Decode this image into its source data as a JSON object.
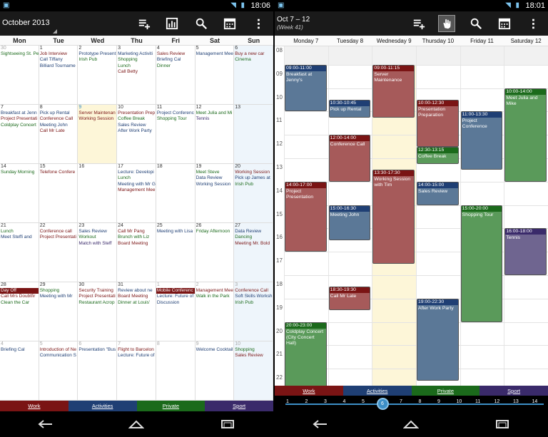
{
  "colors": {
    "work": "#7a1414",
    "activities": "#1f3f74",
    "private": "#1b6a1b",
    "sport": "#3a2a6a"
  },
  "left": {
    "status_time": "18:06",
    "title": "October 2013",
    "action_icons": [
      "add-event-icon",
      "chart-icon",
      "search-icon",
      "calendar-icon",
      "overflow-menu-icon"
    ],
    "weekdays": [
      "Mon",
      "Tue",
      "Wed",
      "Thu",
      "Fri",
      "Sat",
      "Sun"
    ],
    "categories": [
      "Work",
      "Activities",
      "Private",
      "Sport"
    ],
    "weeks": [
      [
        {
          "d": "30",
          "dim": true,
          "ev": [
            [
              "Sightseeing St. Pe",
              "p"
            ]
          ]
        },
        {
          "d": "1",
          "ev": [
            [
              "Job Interview",
              "w"
            ],
            [
              "Call Tiffany",
              "a"
            ],
            [
              "Billiard Tourname",
              "a"
            ]
          ]
        },
        {
          "d": "2",
          "ev": [
            [
              "Prototype Present",
              "a"
            ],
            [
              "Irish Pub",
              "p"
            ]
          ]
        },
        {
          "d": "3",
          "ev": [
            [
              "Marketing Activiti",
              "a"
            ],
            [
              "Shopping",
              "p"
            ],
            [
              "Lunch",
              "p"
            ],
            [
              "Call Betty",
              "w"
            ]
          ]
        },
        {
          "d": "4",
          "ev": [
            [
              "Sales Review",
              "w"
            ],
            [
              "Briefing Cal",
              "a"
            ],
            [
              "Dinner",
              "p"
            ]
          ]
        },
        {
          "d": "5",
          "ev": [
            [
              "Management Mee",
              "a"
            ]
          ]
        },
        {
          "d": "6",
          "ev": [
            [
              "Buy a new car",
              "w"
            ],
            [
              "Cinema",
              "p"
            ]
          ]
        }
      ],
      [
        {
          "d": "7",
          "ev": [
            [
              "Breakfast at Jenn",
              "a"
            ],
            [
              "Project Presentati",
              "w"
            ],
            [
              "Coldplay Concert",
              "p"
            ]
          ]
        },
        {
          "d": "8",
          "ev": [
            [
              "Pick up Rental",
              "a"
            ],
            [
              "Conference Call",
              "w"
            ],
            [
              "Meeting John",
              "a"
            ],
            [
              "Call Mr Late",
              "w"
            ]
          ]
        },
        {
          "d": "9",
          "ev": [
            [
              "Server Maintenan",
              "w"
            ],
            [
              "Working Session",
              "w"
            ]
          ],
          "today": true
        },
        {
          "d": "10",
          "ev": [
            [
              "Presentation Prep",
              "w"
            ],
            [
              "Coffee Break",
              "p"
            ],
            [
              "Sales Review",
              "a"
            ],
            [
              "After Work Party",
              "a"
            ]
          ]
        },
        {
          "d": "11",
          "ev": [
            [
              "Project Conferenc",
              "a"
            ],
            [
              "Shopping Tour",
              "p"
            ]
          ]
        },
        {
          "d": "12",
          "ev": [
            [
              "Meet Julia and Mi",
              "p"
            ],
            [
              "Tennis",
              "s"
            ]
          ]
        },
        {
          "d": "13",
          "ev": []
        }
      ],
      [
        {
          "d": "14",
          "ev": [
            [
              "Sunday Morning",
              "p"
            ]
          ]
        },
        {
          "d": "15",
          "ev": [
            [
              "Telefone Confere",
              "w"
            ]
          ]
        },
        {
          "d": "16",
          "ev": []
        },
        {
          "d": "17",
          "ev": [
            [
              "Lecture: Developi",
              "a"
            ],
            [
              "Lunch",
              "p"
            ],
            [
              "Meeting with Mr G",
              "a"
            ],
            [
              "Management Mee",
              "w"
            ]
          ]
        },
        {
          "d": "18",
          "ev": []
        },
        {
          "d": "19",
          "ev": [
            [
              "Meet Steve",
              "p"
            ],
            [
              "Data Review",
              "a"
            ],
            [
              "Working Session",
              "a"
            ]
          ]
        },
        {
          "d": "20",
          "ev": [
            [
              "Working Session",
              "w"
            ],
            [
              "Pick up James at",
              "a"
            ],
            [
              "Irish Pub",
              "p"
            ]
          ]
        }
      ],
      [
        {
          "d": "21",
          "ev": [
            [
              "Lunch",
              "p"
            ],
            [
              "Meet Steffi and",
              "a"
            ]
          ]
        },
        {
          "d": "22",
          "ev": [
            [
              "Conference call",
              "w"
            ],
            [
              "Project Presentati",
              "w"
            ]
          ]
        },
        {
          "d": "23",
          "ev": [
            [
              "Sales Review",
              "a"
            ],
            [
              "Workout",
              "p"
            ],
            [
              "Match with Steff",
              "s"
            ]
          ]
        },
        {
          "d": "24",
          "ev": [
            [
              "Call Mr Pang",
              "w"
            ],
            [
              "Brunch with Liz",
              "p"
            ],
            [
              "Board Meeting",
              "w"
            ]
          ]
        },
        {
          "d": "25",
          "ev": [
            [
              "Meeting with Lisa",
              "a"
            ]
          ]
        },
        {
          "d": "26",
          "ev": [
            [
              "Friday Afternoon",
              "p"
            ]
          ]
        },
        {
          "d": "27",
          "ev": [
            [
              "Data Review",
              "a"
            ],
            [
              "Dancing",
              "p"
            ],
            [
              "Meeting Mr. Bold",
              "w"
            ]
          ]
        }
      ],
      [
        {
          "d": "28",
          "ev": [
            [
              "Day Off",
              "hlw"
            ],
            [
              "Call Mrs Doubtfir",
              "w"
            ],
            [
              "Clean the Car",
              "p"
            ]
          ]
        },
        {
          "d": "29",
          "ev": [
            [
              "Shopping",
              "p"
            ],
            [
              "Meeting with Mr",
              "a"
            ]
          ]
        },
        {
          "d": "30",
          "ev": [
            [
              "Security Training",
              "w"
            ],
            [
              "Project Presentati",
              "w"
            ],
            [
              "Restaurant Acrop",
              "p"
            ]
          ]
        },
        {
          "d": "31",
          "ev": [
            [
              "Review about ne",
              "a"
            ],
            [
              "Board Meeting",
              "w"
            ],
            [
              "Dinner at Louis'",
              "p"
            ]
          ]
        },
        {
          "d": "1",
          "dim": true,
          "ev": [
            [
              "Mobile Conferenc",
              "hlw"
            ],
            [
              "Lecture: Future of",
              "a"
            ],
            [
              "Discussion",
              "a"
            ]
          ]
        },
        {
          "d": "2",
          "dim": true,
          "ev": [
            [
              "Management Mee",
              "w"
            ],
            [
              "Walk in the Park",
              "p"
            ]
          ]
        },
        {
          "d": "3",
          "dim": true,
          "ev": [
            [
              "Conference Call",
              "w"
            ],
            [
              "Soft Skills Worksh",
              "a"
            ],
            [
              "Irish Pub",
              "p"
            ]
          ]
        }
      ],
      [
        {
          "d": "4",
          "dim": true,
          "ev": [
            [
              "Briefing Cal",
              "a"
            ]
          ]
        },
        {
          "d": "5",
          "dim": true,
          "ev": [
            [
              "Introduction of Ne",
              "w"
            ],
            [
              "Communication S",
              "a"
            ]
          ]
        },
        {
          "d": "6",
          "dim": true,
          "ev": [
            [
              "Presentation \"Bus",
              "a"
            ]
          ]
        },
        {
          "d": "7",
          "dim": true,
          "ev": [
            [
              "Flight to Barcelon",
              "w"
            ],
            [
              "Lecture: Future of",
              "a"
            ]
          ]
        },
        {
          "d": "8",
          "dim": true,
          "ev": []
        },
        {
          "d": "9",
          "dim": true,
          "ev": [
            [
              "Welcome Cocktail",
              "a"
            ]
          ]
        },
        {
          "d": "10",
          "dim": true,
          "ev": [
            [
              "Shopping",
              "p"
            ],
            [
              "Sales Review",
              "w"
            ]
          ]
        }
      ]
    ]
  },
  "right": {
    "status_time": "18:01",
    "title": "Oct 7 – 12",
    "subtitle": "(Week 41)",
    "action_icons": [
      "add-event-icon",
      "touch-icon",
      "search-icon",
      "calendar-icon",
      "overflow-menu-icon"
    ],
    "days": [
      "Monday 7",
      "Tuesday 8",
      "Wednesday 9",
      "Thursday 10",
      "Friday 11",
      "Saturday 12"
    ],
    "hours": [
      "08",
      "09",
      "10",
      "11",
      "12",
      "13",
      "14",
      "15",
      "16",
      "17",
      "18",
      "19",
      "20",
      "21",
      "22"
    ],
    "categories": [
      "Work",
      "Activities",
      "Private",
      "Sport"
    ],
    "slider_ticks": [
      "1",
      "2",
      "3",
      "4",
      "5",
      "6",
      "7",
      "8",
      "9",
      "10",
      "11",
      "12",
      "13",
      "14"
    ],
    "slider_value": "6",
    "events": [
      {
        "day": 0,
        "start": 9.0,
        "end": 11.0,
        "time": "09:00-11:00",
        "text": "Breakfast at Jenny's",
        "cat": "activities"
      },
      {
        "day": 0,
        "start": 14.0,
        "end": 17.0,
        "time": "14:00-17:00",
        "text": "Project Presentation",
        "cat": "work"
      },
      {
        "day": 0,
        "start": 20.0,
        "end": 23.0,
        "time": "20:00-23:00",
        "text": "Coldplay Concert (City Concert Hall)",
        "cat": "private"
      },
      {
        "day": 1,
        "start": 10.5,
        "end": 11.25,
        "time": "10:30-10:45",
        "text": "Pick up Rental",
        "cat": "activities"
      },
      {
        "day": 1,
        "start": 12.0,
        "end": 14.0,
        "time": "12:00-14:00",
        "text": "Conference Call",
        "cat": "work"
      },
      {
        "day": 1,
        "start": 15.0,
        "end": 16.5,
        "time": "15:00-16:30",
        "text": "Meeting John",
        "cat": "activities"
      },
      {
        "day": 1,
        "start": 18.5,
        "end": 19.5,
        "time": "18:30-19:30",
        "text": "Call Mr Late",
        "cat": "work"
      },
      {
        "day": 2,
        "start": 9.0,
        "end": 11.25,
        "time": "09:00-11:15",
        "text": "Server Maintenance",
        "cat": "work"
      },
      {
        "day": 2,
        "start": 13.5,
        "end": 17.5,
        "time": "13:30-17:30",
        "text": "Working Session with Tim",
        "cat": "work"
      },
      {
        "day": 3,
        "start": 10.5,
        "end": 12.5,
        "time": "10:00-12:30",
        "text": "Presentation Preparation",
        "cat": "work"
      },
      {
        "day": 3,
        "start": 12.5,
        "end": 13.25,
        "time": "12:30-13:15",
        "text": "Coffee Break",
        "cat": "private"
      },
      {
        "day": 3,
        "start": 14.0,
        "end": 15.0,
        "time": "14:00-15:00",
        "text": "Sales Review",
        "cat": "activities"
      },
      {
        "day": 3,
        "start": 19.0,
        "end": 22.5,
        "time": "19:00-22:30",
        "text": "After Work Party",
        "cat": "activities"
      },
      {
        "day": 4,
        "start": 11.0,
        "end": 13.5,
        "time": "11:00-13:30",
        "text": "Project Conference",
        "cat": "activities"
      },
      {
        "day": 4,
        "start": 15.0,
        "end": 20.0,
        "time": "15:00-20:00",
        "text": "Shopping Tour",
        "cat": "private"
      },
      {
        "day": 5,
        "start": 10.0,
        "end": 14.0,
        "time": "10:00-14:00",
        "text": "Meet Julia and Mike",
        "cat": "private"
      },
      {
        "day": 5,
        "start": 16.0,
        "end": 18.0,
        "time": "16:00-18:00",
        "text": "Tennis",
        "cat": "sport"
      }
    ]
  }
}
